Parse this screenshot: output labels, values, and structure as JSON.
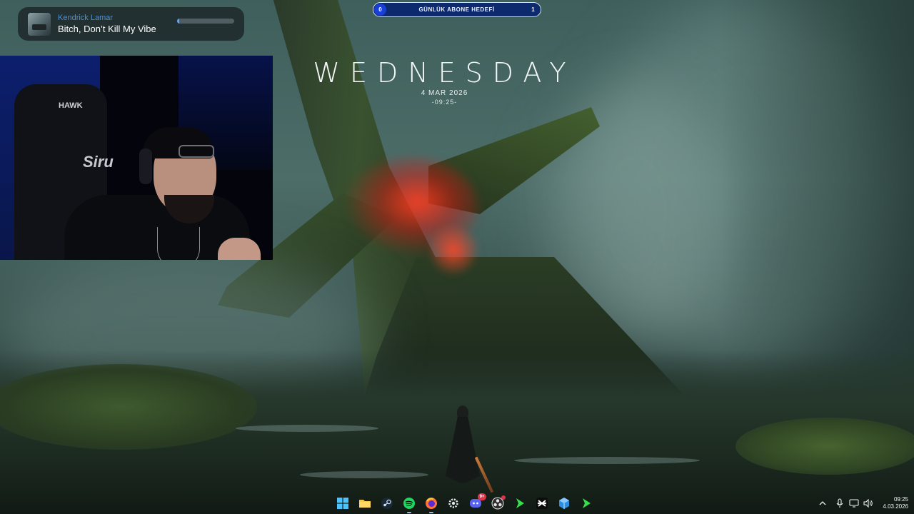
{
  "now_playing": {
    "artist": "Kendrick Lamar",
    "title": "Bitch, Don’t Kill My Vibe",
    "progress": 0.04,
    "art_icon": "album-art"
  },
  "goal_bar": {
    "current": "0",
    "label": "GÜNLÜK ABONE HEDEFİ",
    "target": "1",
    "color": "#1a3fd9"
  },
  "day_widget": {
    "day": "WEDNESDAY",
    "date": "4 MAR 2026",
    "time": "-09:25-"
  },
  "webcam": {
    "chair_brand": "HAWK",
    "chair_text": "Siru"
  },
  "taskbar": {
    "apps": [
      {
        "name": "windows-start",
        "icon": "windows-icon"
      },
      {
        "name": "file-explorer",
        "icon": "folder-icon"
      },
      {
        "name": "steam",
        "icon": "steam-icon"
      },
      {
        "name": "spotify",
        "icon": "spotify-icon",
        "active": true
      },
      {
        "name": "firefox",
        "icon": "firefox-icon",
        "active": true
      },
      {
        "name": "settings",
        "icon": "gear-icon"
      },
      {
        "name": "discord",
        "icon": "discord-icon",
        "badge": "9+"
      },
      {
        "name": "obs-studio",
        "icon": "obs-icon",
        "dot": true
      },
      {
        "name": "game-launcher",
        "icon": "green-arrow-icon"
      },
      {
        "name": "capcut",
        "icon": "capcut-icon"
      },
      {
        "name": "gpu-app",
        "icon": "cube-icon"
      },
      {
        "name": "game-launcher-2",
        "icon": "green-arrow-icon"
      }
    ],
    "tray": {
      "clock_time": "09:25",
      "clock_date": "4.03.2026",
      "icons": [
        "chevron-up-icon",
        "microphone-icon",
        "display-icon",
        "speaker-icon"
      ]
    }
  },
  "colors": {
    "accent_blue": "#4f8fd1",
    "goal_fill": "#0d2a6e",
    "glow_red": "#ff3c1e"
  }
}
